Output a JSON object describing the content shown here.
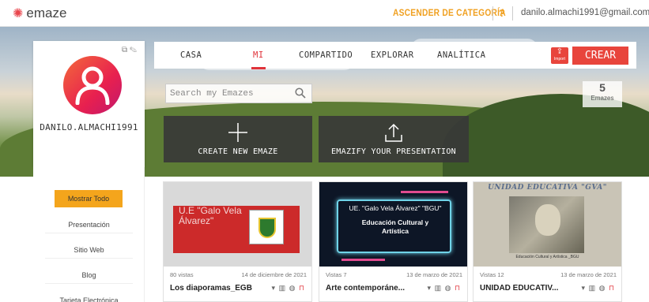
{
  "topbar": {
    "logo": "emaze",
    "upgrade": "ASCENDER DE CATEGORÍA",
    "help": "?",
    "email": "danilo.almachi1991@gmail.com"
  },
  "profile": {
    "username": "DANILO.ALMACHI1991"
  },
  "sidebar": {
    "items": [
      {
        "label": "Mostrar Todo",
        "active": true
      },
      {
        "label": "Presentación"
      },
      {
        "label": "Sitio Web"
      },
      {
        "label": "Blog"
      },
      {
        "label": "Tarjeta Electrónica"
      }
    ]
  },
  "nav": {
    "tabs": [
      {
        "label": "CASA"
      },
      {
        "label": "MI",
        "active": true
      },
      {
        "label": "COMPARTIDO"
      },
      {
        "label": "EXPLORAR"
      },
      {
        "label": "ANALÍTICA"
      }
    ],
    "import_label": "Import",
    "create_label": "CREAR"
  },
  "search": {
    "placeholder": "Search my Emazes"
  },
  "count": {
    "value": "5",
    "label": "Emazes"
  },
  "actions": {
    "create": "CREATE NEW EMAZE",
    "emazify": "EMAZIFY YOUR PRESENTATION"
  },
  "cards": [
    {
      "views": "80 vistas",
      "date": "14 de diciembre de 2021",
      "title": "Los diaporamas_EGB",
      "thumb_text": "U.E \"Galo Vela Álvarez\""
    },
    {
      "views": "Vistas 7",
      "date": "13 de marzo de 2021",
      "title": "Arte contemporáne...",
      "thumb_title": "UE. \"Galo Vela Álvarez\" \"BGU\"",
      "thumb_sub": "Educación Cultural y Artística"
    },
    {
      "views": "Vistas 12",
      "date": "13 de marzo de 2021",
      "title": "UNIDAD EDUCATIV...",
      "thumb_head": "UNIDAD EDUCATIVA \"GVA\"",
      "thumb_caption": "Educación Cultural y Artística _BGU"
    }
  ],
  "colors": {
    "accent": "#e8453c",
    "upgrade": "#f0a020",
    "active_filter": "#f4a51c"
  }
}
